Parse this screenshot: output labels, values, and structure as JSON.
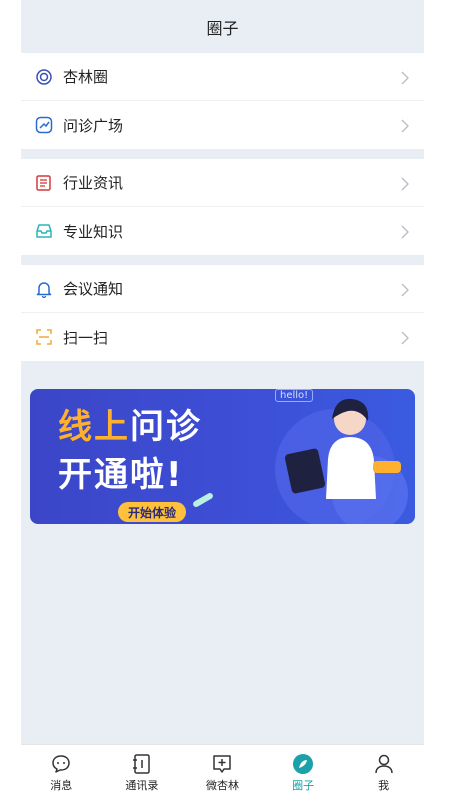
{
  "header": {
    "title": "圈子"
  },
  "groups": [
    [
      {
        "label": "杏林圈",
        "icon": "target-icon"
      },
      {
        "label": "问诊广场",
        "icon": "stethoscope-icon"
      }
    ],
    [
      {
        "label": "行业资讯",
        "icon": "news-icon"
      },
      {
        "label": "专业知识",
        "icon": "inbox-icon"
      }
    ],
    [
      {
        "label": "会议通知",
        "icon": "bell-icon"
      },
      {
        "label": "扫一扫",
        "icon": "scan-icon"
      }
    ]
  ],
  "banner": {
    "title_part1": "线上",
    "title_part2": "问诊",
    "title_line2": "开通啦!",
    "cta": "开始体验",
    "hello": "hello!"
  },
  "tabbar": [
    {
      "label": "消息",
      "icon": "chat-icon"
    },
    {
      "label": "通讯录",
      "icon": "contacts-icon"
    },
    {
      "label": "微杏林",
      "icon": "add-post-icon"
    },
    {
      "label": "圈子",
      "icon": "compass-icon",
      "active": true
    },
    {
      "label": "我",
      "icon": "user-icon"
    }
  ],
  "colors": {
    "accent": "#1aa2a8",
    "background": "#e9eef5"
  }
}
